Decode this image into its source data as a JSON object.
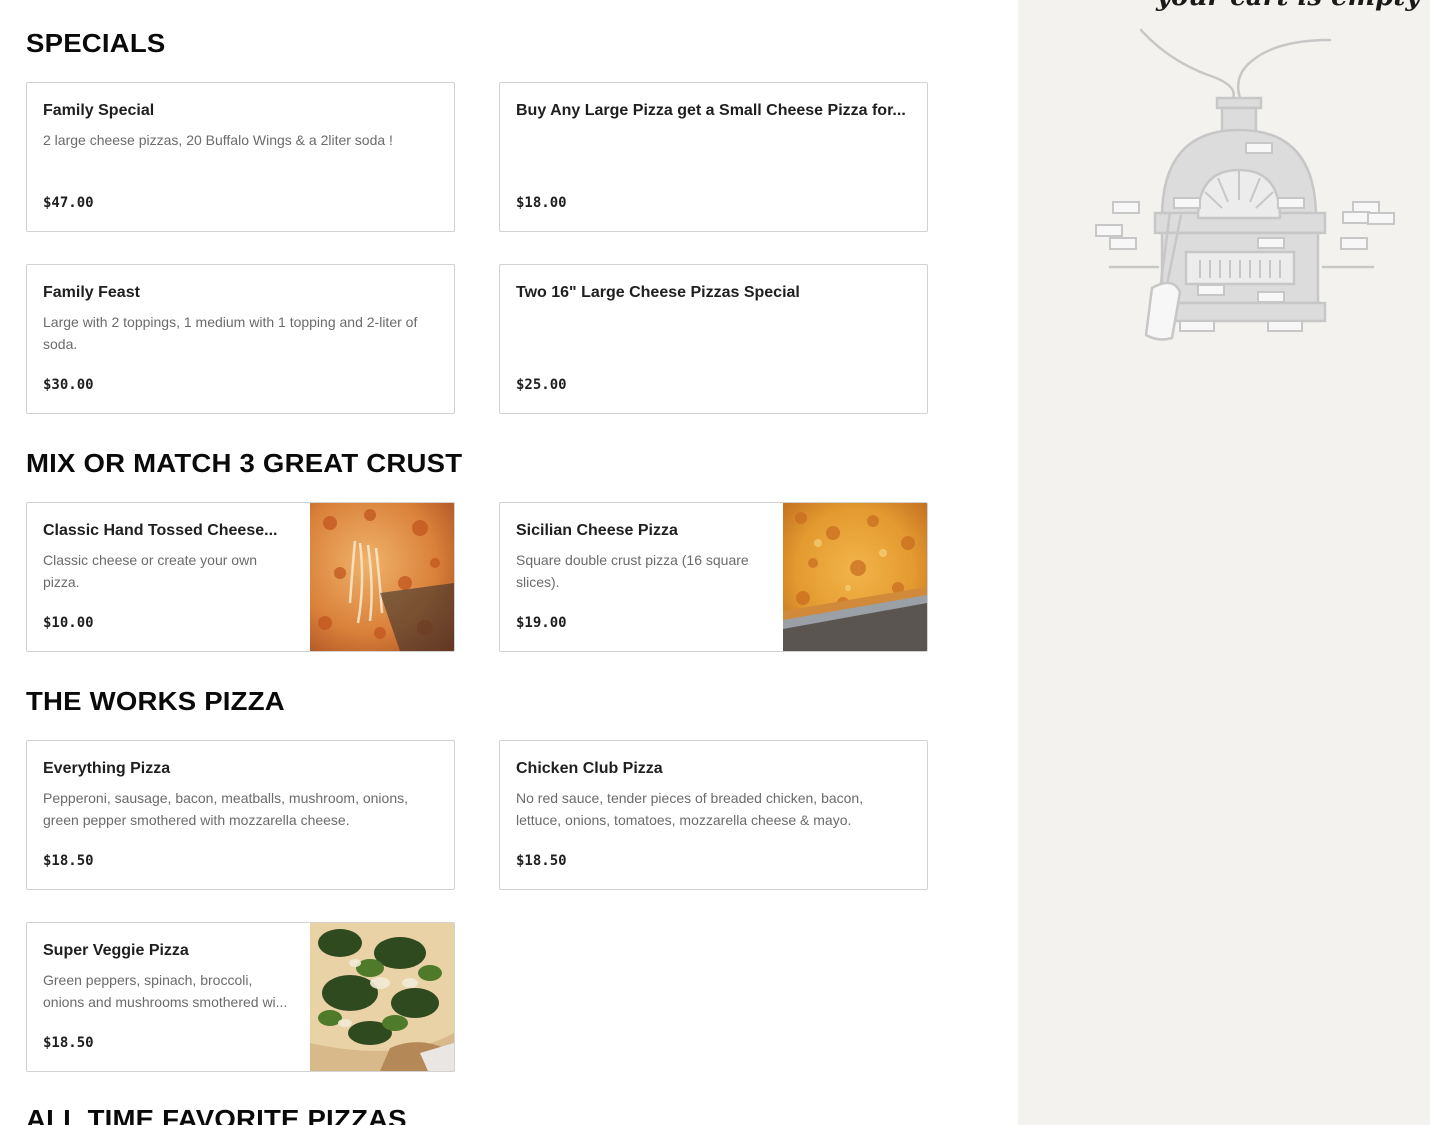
{
  "sections": [
    {
      "title": "SPECIALS",
      "items": [
        {
          "name": "Family Special",
          "desc": "2 large cheese pizzas, 20 Buffalo Wings & a 2liter soda !",
          "price": "$47.00"
        },
        {
          "name": "Buy Any Large Pizza get a Small Cheese Pizza for...",
          "desc": "",
          "price": "$18.00"
        },
        {
          "name": "Family Feast",
          "desc": "Large with 2 toppings, 1 medium with 1 topping and 2-liter of soda.",
          "price": "$30.00"
        },
        {
          "name": "Two 16\" Large Cheese Pizzas Special",
          "desc": "",
          "price": "$25.00"
        }
      ]
    },
    {
      "title": "MIX OR MATCH 3 GREAT CRUST",
      "items": [
        {
          "name": "Classic Hand Tossed Cheese...",
          "desc": "Classic cheese or create your own pizza.",
          "price": "$10.00"
        },
        {
          "name": "Sicilian Cheese Pizza",
          "desc": "Square double crust pizza (16 square slices).",
          "price": "$19.00"
        }
      ]
    },
    {
      "title": "THE WORKS PIZZA",
      "items": [
        {
          "name": "Everything Pizza",
          "desc": "Pepperoni, sausage, bacon, meatballs, mushroom, onions, green pepper smothered with mozzarella cheese.",
          "price": "$18.50"
        },
        {
          "name": "Chicken Club Pizza",
          "desc": "No red sauce, tender pieces of breaded chicken, bacon, lettuce, onions, tomatoes, mozzarella cheese & mayo.",
          "price": "$18.50"
        },
        {
          "name": "Super Veggie Pizza",
          "desc": "Green peppers, spinach, broccoli, onions and mushrooms smothered wi...",
          "price": "$18.50"
        }
      ]
    },
    {
      "title": "ALL TIME FAVORITE PIZZAS",
      "items": []
    }
  ],
  "cart": {
    "empty_message": "your cart is empty"
  }
}
